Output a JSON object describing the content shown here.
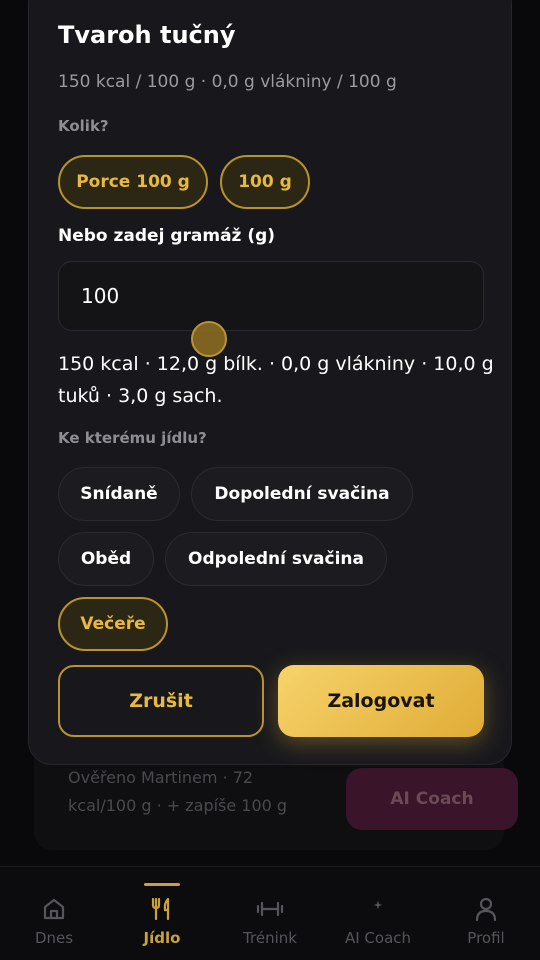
{
  "background": {
    "note": "Ověřeno Martinem · 72 kcal/100 g · + zapíše 100 g",
    "coach_button": "AI Coach"
  },
  "modal": {
    "title": "Tvaroh tučný",
    "subtitle": "150 kcal / 100 g · 0,0 g vlákniny / 100 g",
    "amount_label": "Kolik?",
    "portion_chips": [
      {
        "label": "Porce 100 g",
        "selected": true
      },
      {
        "label": "100 g",
        "selected": true
      }
    ],
    "grams_label": "Nebo zadej gramáž (g)",
    "grams_value": "100",
    "nutrition_summary": "150 kcal · 12,0 g bílk. · 0,0 g vlákniny · 10,0 g tuků · 3,0 g sach.",
    "meal_label": "Ke kterému jídlu?",
    "meals": [
      {
        "label": "Snídaně",
        "selected": false
      },
      {
        "label": "Dopolední svačina",
        "selected": false
      },
      {
        "label": "Oběd",
        "selected": false
      },
      {
        "label": "Odpolední svačina",
        "selected": false
      },
      {
        "label": "Večeře",
        "selected": true
      }
    ],
    "cancel_label": "Zrušit",
    "log_label": "Zalogovat"
  },
  "nav": {
    "items": [
      {
        "label": "Dnes",
        "icon": "home-icon",
        "active": false
      },
      {
        "label": "Jídlo",
        "icon": "fork-knife-icon",
        "active": true
      },
      {
        "label": "Trénink",
        "icon": "dumbbell-icon",
        "active": false
      },
      {
        "label": "AI Coach",
        "icon": "sparkle-icon",
        "active": false
      },
      {
        "label": "Profil",
        "icon": "person-icon",
        "active": false
      }
    ]
  },
  "colors": {
    "accent": "#e8b83f",
    "modal_bg": "#18181c",
    "page_bg": "#09090b"
  }
}
